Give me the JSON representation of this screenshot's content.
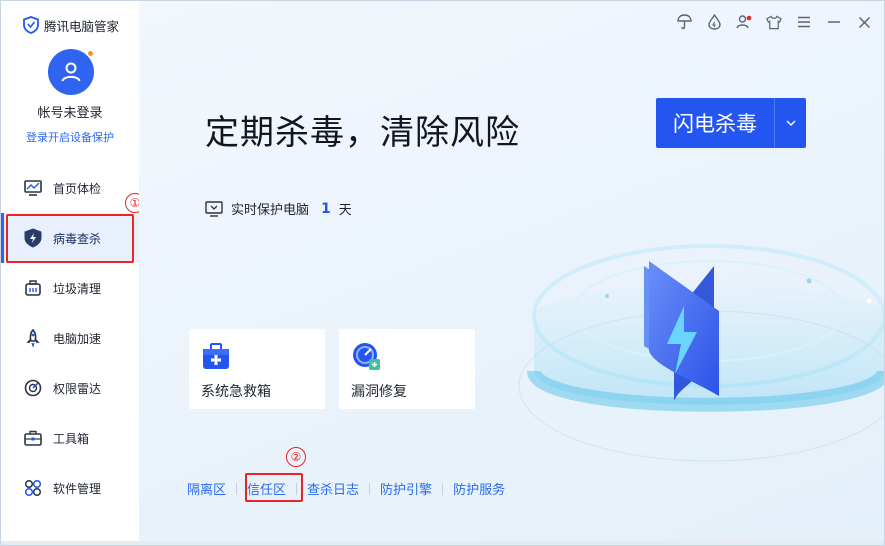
{
  "app": {
    "title": "腾讯电脑管家"
  },
  "account": {
    "status": "帐号未登录",
    "login_link": "登录开启设备保护"
  },
  "sidebar": {
    "items": [
      {
        "label": "首页体检",
        "icon": "monitor-icon"
      },
      {
        "label": "病毒查杀",
        "icon": "shield-bolt-icon",
        "active": true
      },
      {
        "label": "垃圾清理",
        "icon": "broom-icon"
      },
      {
        "label": "电脑加速",
        "icon": "rocket-icon"
      },
      {
        "label": "权限雷达",
        "icon": "radar-icon"
      },
      {
        "label": "工具箱",
        "icon": "toolbox-icon"
      },
      {
        "label": "软件管理",
        "icon": "apps-icon"
      }
    ]
  },
  "annotations": {
    "marker1": "①",
    "marker2": "②"
  },
  "topbar": {
    "icons": [
      "umbrella-icon",
      "drop-icon",
      "user-alert-icon",
      "shirt-icon",
      "menu-icon",
      "minimize-icon",
      "close-icon"
    ]
  },
  "main": {
    "headline": "定期杀毒，清除风险",
    "scan_button": "闪电杀毒",
    "protect_text": "实时保护电脑",
    "protect_days": "1",
    "protect_unit": "天",
    "tools": [
      {
        "label": "系统急救箱",
        "icon": "first-aid-kit-icon"
      },
      {
        "label": "漏洞修复",
        "icon": "patch-icon"
      }
    ],
    "links": [
      "隔离区",
      "信任区",
      "查杀日志",
      "防护引擎",
      "防护服务"
    ]
  },
  "colors": {
    "accent": "#2356f0",
    "link": "#2a6bf0",
    "highlight": "#e8262a"
  }
}
